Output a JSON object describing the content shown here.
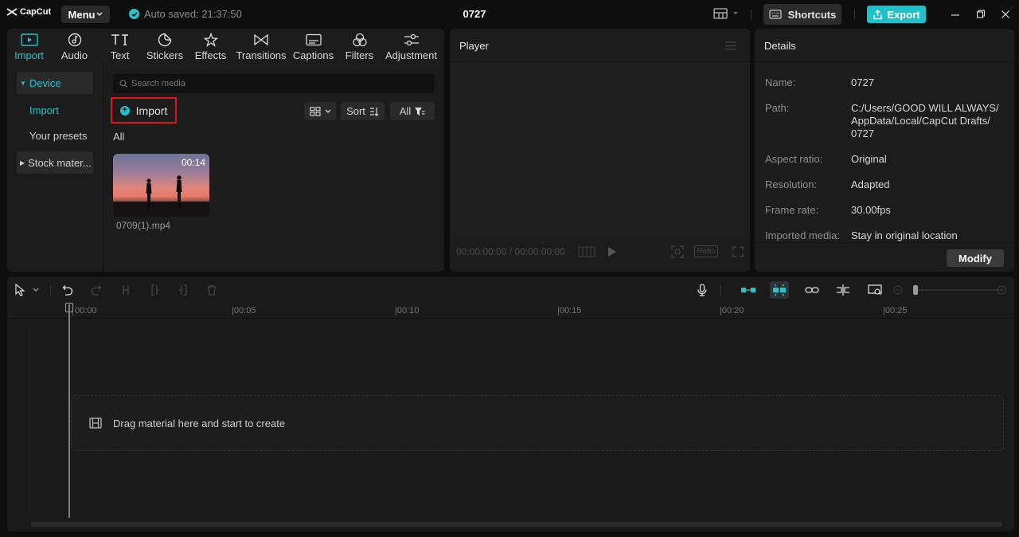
{
  "titlebar": {
    "logo": "CapCut",
    "menu": "Menu",
    "autosave": "Auto saved: 21:37:50",
    "project_title": "0727",
    "shortcuts": "Shortcuts",
    "export": "Export"
  },
  "media": {
    "tabs": [
      {
        "label": "Import",
        "icon": "import-icon",
        "active": true
      },
      {
        "label": "Audio",
        "icon": "audio-icon"
      },
      {
        "label": "Text",
        "icon": "text-icon"
      },
      {
        "label": "Stickers",
        "icon": "stickers-icon"
      },
      {
        "label": "Effects",
        "icon": "effects-icon"
      },
      {
        "label": "Transitions",
        "icon": "transitions-icon"
      },
      {
        "label": "Captions",
        "icon": "captions-icon"
      },
      {
        "label": "Filters",
        "icon": "filters-icon"
      },
      {
        "label": "Adjustment",
        "icon": "adjustment-icon"
      }
    ],
    "sidebar": {
      "device": "Device",
      "import": "Import",
      "presets": "Your presets",
      "stock": "Stock mater..."
    },
    "search_placeholder": "Search media",
    "import_button": "Import",
    "sort": "Sort",
    "filter_all": "All",
    "group_label": "All",
    "items": [
      {
        "name": "0709(1).mp4",
        "duration": "00:14"
      }
    ]
  },
  "player": {
    "title": "Player",
    "timecode": "00:00:00:00 / 00:00:00:00",
    "ratio": "Ratio"
  },
  "details": {
    "title": "Details",
    "rows": [
      {
        "label": "Name:",
        "value": "0727"
      },
      {
        "label": "Path:",
        "value": "C:/Users/GOOD WILL ALWAYS/ AppData/Local/CapCut Drafts/ 0727"
      },
      {
        "label": "Aspect ratio:",
        "value": "Original"
      },
      {
        "label": "Resolution:",
        "value": "Adapted"
      },
      {
        "label": "Frame rate:",
        "value": "30.00fps"
      },
      {
        "label": "Imported media:",
        "value": "Stay in original location"
      }
    ],
    "modify": "Modify"
  },
  "timeline": {
    "ticks": [
      "00:00",
      "|00:05",
      "|00:10",
      "|00:15",
      "|00:20",
      "|00:25"
    ],
    "dropzone": "Drag material here and start to create"
  },
  "colors": {
    "accent": "#1ec0c9",
    "highlight_border": "#e0151b",
    "background": "#0e0e0e",
    "panel": "#1c1c1c"
  }
}
